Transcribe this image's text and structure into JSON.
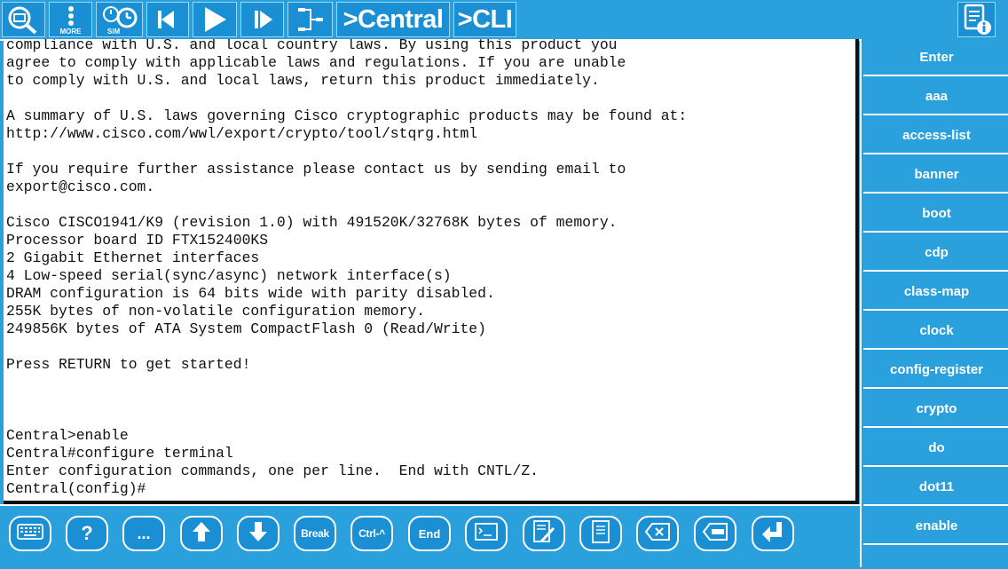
{
  "toolbar": {
    "more_label": "MORE",
    "sim_label": "SIM",
    "central_label": ">Central",
    "cli_label": ">CLI"
  },
  "terminal": {
    "lines": [
      "compliance with U.S. and local country laws. By using this product you",
      "agree to comply with applicable laws and regulations. If you are unable",
      "to comply with U.S. and local laws, return this product immediately.",
      "",
      "A summary of U.S. laws governing Cisco cryptographic products may be found at:",
      "http://www.cisco.com/wwl/export/crypto/tool/stqrg.html",
      "",
      "If you require further assistance please contact us by sending email to",
      "export@cisco.com.",
      "",
      "Cisco CISCO1941/K9 (revision 1.0) with 491520K/32768K bytes of memory.",
      "Processor board ID FTX152400KS",
      "2 Gigabit Ethernet interfaces",
      "4 Low-speed serial(sync/async) network interface(s)",
      "DRAM configuration is 64 bits wide with parity disabled.",
      "255K bytes of non-volatile configuration memory.",
      "249856K bytes of ATA System CompactFlash 0 (Read/Write)",
      "",
      "Press RETURN to get started!",
      "",
      "",
      "",
      "Central>enable",
      "Central#configure terminal",
      "Enter configuration commands, one per line.  End with CNTL/Z.",
      "Central(config)#"
    ]
  },
  "commands": [
    "Enter",
    "aaa",
    "access-list",
    "banner",
    "boot",
    "cdp",
    "class-map",
    "clock",
    "config-register",
    "crypto",
    "do",
    "dot11",
    "enable"
  ],
  "bottombar": {
    "help_label": "?",
    "more_label": "...",
    "break_label": "Break",
    "ctrl_label": "Ctrl-^",
    "end_label": "End"
  },
  "icons": {
    "toolbar": [
      "search-device-icon",
      "more-icon",
      "sim-clock-icon",
      "step-back-icon",
      "play-icon",
      "step-forward-icon",
      "topology-icon"
    ],
    "info": "info-icon",
    "bottom": [
      "keyboard-icon",
      "arrow-up-icon",
      "arrow-down-icon",
      "prompt-icon",
      "edit-icon",
      "document-icon",
      "backspace-icon",
      "delete-word-icon",
      "return-icon"
    ]
  },
  "colors": {
    "background": "#2aa0dc",
    "button": "#1b8fd3",
    "terminal_bg": "#ffffff",
    "terminal_text": "#111111"
  }
}
